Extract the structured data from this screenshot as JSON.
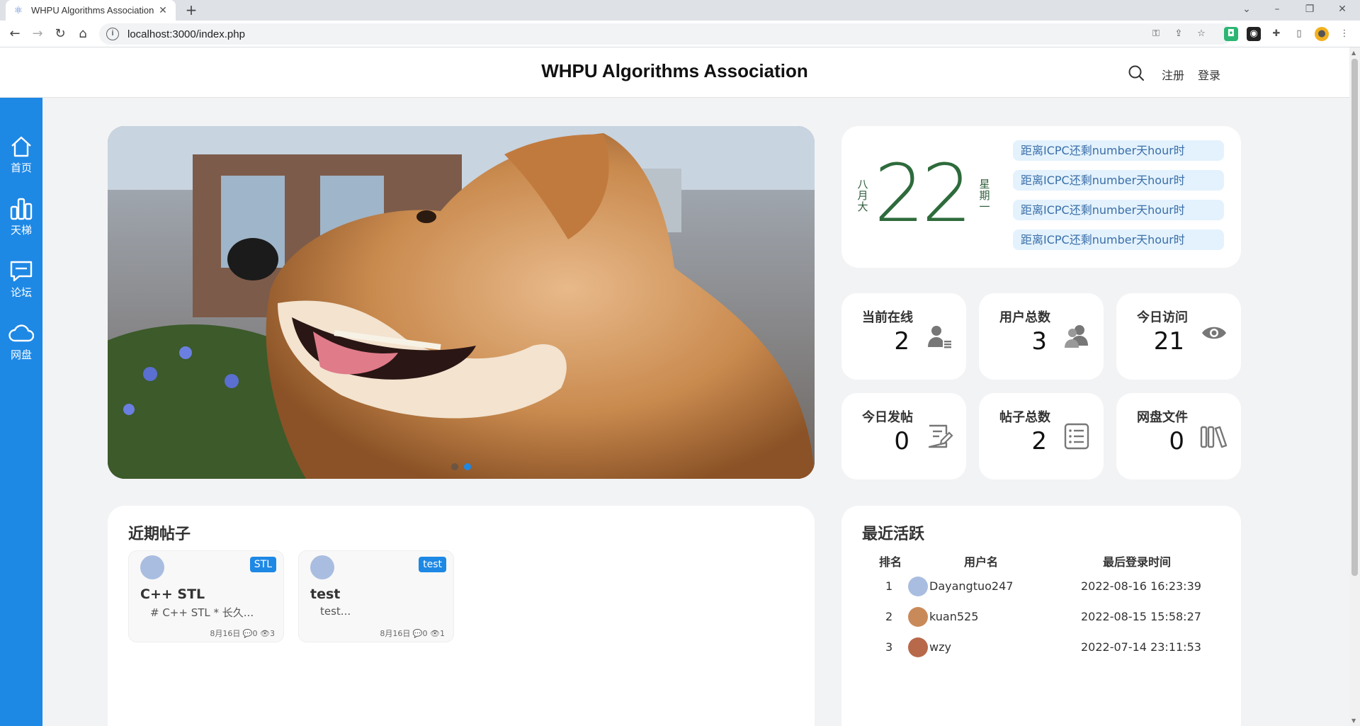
{
  "browser": {
    "tab_title": "WHPU Algorithms Association",
    "tab_close": "✕",
    "new_tab": "+",
    "url": "localhost:3000/index.php"
  },
  "header": {
    "title": "WHPU Algorithms Association",
    "register": "注册",
    "login": "登录"
  },
  "sidebar": {
    "items": [
      {
        "label": "首页",
        "icon": "home-icon"
      },
      {
        "label": "天梯",
        "icon": "bar-chart-icon"
      },
      {
        "label": "论坛",
        "icon": "chat-icon"
      },
      {
        "label": "网盘",
        "icon": "cloud-icon"
      }
    ]
  },
  "carousel": {
    "slides": 2,
    "active_slide": 2
  },
  "calendar": {
    "month": "八月大",
    "day": "22",
    "weekday": "星期一",
    "countdowns": [
      "距离ICPC还剩number天hour时",
      "距离ICPC还剩number天hour时",
      "距离ICPC还剩number天hour时",
      "距离ICPC还剩number天hour时"
    ]
  },
  "stats": [
    {
      "label": "当前在线",
      "value": "2",
      "icon": "user-list-icon"
    },
    {
      "label": "用户总数",
      "value": "3",
      "icon": "users-icon"
    },
    {
      "label": "今日访问",
      "value": "21",
      "icon": "eye-icon"
    },
    {
      "label": "今日发帖",
      "value": "0",
      "icon": "edit-note-icon"
    },
    {
      "label": "帖子总数",
      "value": "2",
      "icon": "list-icon"
    },
    {
      "label": "网盘文件",
      "value": "0",
      "icon": "books-icon"
    }
  ],
  "recent_posts": {
    "title": "近期帖子",
    "posts": [
      {
        "tag": "STL",
        "title": "C++ STL",
        "excerpt": "# C++ STL * 长久...",
        "meta": "8月16日 💬0 👁3"
      },
      {
        "tag": "test",
        "title": "test",
        "excerpt": "test...",
        "meta": "8月16日 💬0 👁1"
      }
    ]
  },
  "recent_active": {
    "title": "最近活跃",
    "headers": {
      "rank": "排名",
      "username": "用户名",
      "last_login": "最后登录时间"
    },
    "rows": [
      {
        "rank": "1",
        "username": "Dayangtuo247",
        "last_login": "2022-08-16 16:23:39"
      },
      {
        "rank": "2",
        "username": "kuan525",
        "last_login": "2022-08-15 15:58:27"
      },
      {
        "rank": "3",
        "username": "wzy",
        "last_login": "2022-07-14 23:11:53"
      }
    ]
  },
  "colors": {
    "accent": "#1e88e5",
    "calendar_green": "#2e6b3c",
    "countdown_bg": "#e3f2fd"
  }
}
